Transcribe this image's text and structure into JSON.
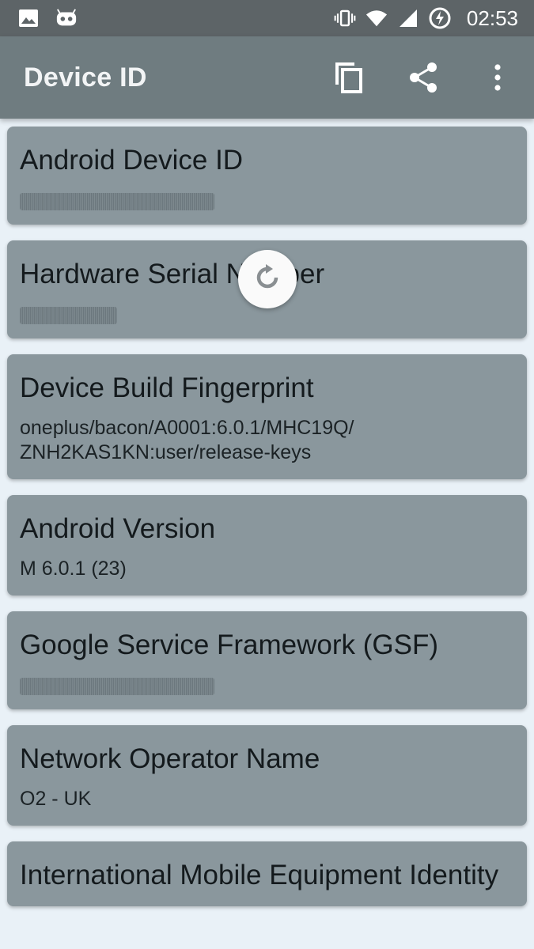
{
  "status_bar": {
    "time": "02:53",
    "left_icons": [
      "image-icon",
      "android-robot-icon"
    ],
    "right_icons": [
      "vibrate-icon",
      "wifi-icon",
      "cell-signal-icon",
      "battery-charging-icon"
    ]
  },
  "app_bar": {
    "title": "Device ID",
    "actions": [
      "copy-icon",
      "share-icon",
      "more-vert-icon"
    ]
  },
  "colors": {
    "status_bar": "#5d6467",
    "app_bar": "#6f7c80",
    "card": "#8a979d",
    "background": "#e9f1f7"
  },
  "cards": [
    {
      "title": "Android Device ID",
      "value": "",
      "redacted": true
    },
    {
      "title": "Hardware Serial Number",
      "value": "",
      "redacted": true
    },
    {
      "title": "Device Build Fingerprint",
      "value": "oneplus/bacon/A0001:6.0.1/MHC19Q/\nZNH2KAS1KN:user/release-keys",
      "redacted": false
    },
    {
      "title": "Android Version",
      "value": "M 6.0.1 (23)",
      "redacted": false
    },
    {
      "title": "Google Service Framework (GSF)",
      "value": "",
      "redacted": true
    },
    {
      "title": "Network Operator Name",
      "value": "O2 - UK",
      "redacted": false
    },
    {
      "title": "International Mobile Equipment Identity",
      "value": "",
      "redacted": false
    }
  ],
  "refresh_indicator": {
    "icon": "refresh-icon"
  }
}
